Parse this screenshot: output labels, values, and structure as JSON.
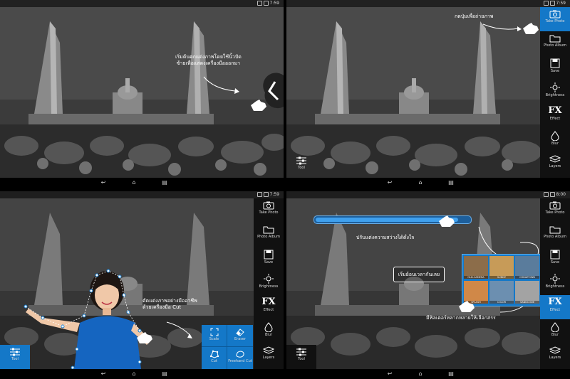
{
  "status": {
    "clock1": "7:59",
    "clock2": "7:59",
    "clock3": "7:59",
    "clock4": "8:00"
  },
  "captions": {
    "p1_line1": "เริ่มต้นตกแต่งภาพโดยใช้นิ้วปัด",
    "p1_line2": "ซ้ายเพื่อแสดงเครื่องมือออกมา",
    "p2": "กดปุ่มเพื่อถ่ายภาพ",
    "p3_line1": "ตัดแต่งภาพอย่างมืออาชีพ",
    "p3_line2": "ด้วยเครื่องมือ Cut",
    "p4_slider": "ปรับแต่งความสว่างได้ดั่งใจ",
    "p4_start_button": "เริ่มย้อนเวลากันเลย",
    "p4_filter": "มีฟิลเตอร์หลากหลายให้เลือกสรร"
  },
  "tools": {
    "take_photo": "Take Photo",
    "photo_album": "Photo Album",
    "save": "Save",
    "brightness": "Brightness",
    "fx": "FX",
    "effect": "Effect",
    "blur": "Blur",
    "layers": "Layers",
    "tool": "Tool"
  },
  "cut_tools": {
    "scale": "Scale",
    "eraser": "Eraser",
    "cut": "Cut",
    "freehand_cut": "Freehand Cut"
  },
  "filters": [
    "OLD-CAMERA",
    "SUNNY",
    "CHINATOWN",
    "SPLASH",
    "COLOR",
    "SANDCODE"
  ],
  "colors": {
    "accent": "#1478c8",
    "toolbar": "#111111",
    "shirt": "#1565c0"
  },
  "icons": [
    "camera-icon",
    "folder-icon",
    "save-icon",
    "sun-icon",
    "drop-icon",
    "layers-icon",
    "sliders-icon",
    "hand-pointer-icon",
    "scale-icon",
    "eraser-icon",
    "cut-icon",
    "freehand-cut-icon",
    "back-icon",
    "home-icon",
    "recents-icon"
  ]
}
